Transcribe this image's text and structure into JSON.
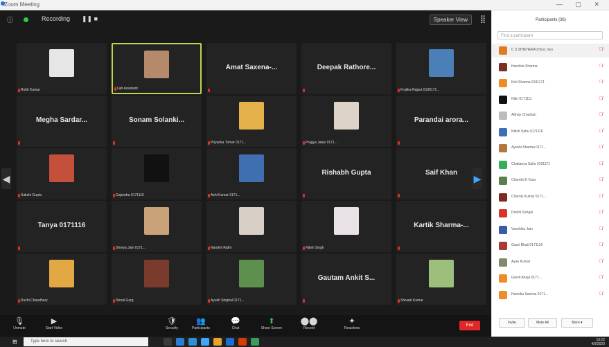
{
  "window": {
    "title": "Zoom Meeting",
    "controls": "— ▢ ✕"
  },
  "topbar": {
    "recording": "Recording",
    "pause_stop": "❚❚ ■",
    "speaker_view": "Speaker View",
    "grid_glyph": "⣿"
  },
  "tiles": [
    {
      "label": "Rohit Kumar",
      "type": "photo",
      "color": "#e6e6e6",
      "active": false
    },
    {
      "label": "Lab Assistant",
      "type": "photo",
      "color": "#b58a6a",
      "active": true
    },
    {
      "label": "",
      "big": "Amat Saxena-...",
      "type": "name",
      "active": false
    },
    {
      "label": "",
      "big": "Deepak Rathore...",
      "type": "name",
      "active": false
    },
    {
      "label": "Krutika Rajput 0190171...",
      "type": "photo",
      "color": "#4a7fb8",
      "active": false
    },
    {
      "label": "",
      "big": "Megha Sardar...",
      "type": "name",
      "active": false
    },
    {
      "label": "",
      "big": "Sonam Solanki...",
      "type": "name",
      "active": false
    },
    {
      "label": "Priyanka Tomar 0171...",
      "type": "photo",
      "color": "#e3b04a",
      "active": false
    },
    {
      "label": "Pragya Jatav 0171...",
      "type": "photo",
      "color": "#ddd3c8",
      "active": false
    },
    {
      "label": "",
      "big": "Parandai arora...",
      "type": "name",
      "active": false
    },
    {
      "label": "Sakshi Gupta",
      "type": "photo",
      "color": "#c4503c",
      "active": false
    },
    {
      "label": "Gajendra 0171116",
      "type": "photo",
      "color": "#111111",
      "active": false
    },
    {
      "label": "Ashi Kumar 0171...",
      "type": "photo",
      "color": "#3f6fb0",
      "active": false
    },
    {
      "label": "",
      "big": "Rishabh Gupta",
      "type": "name",
      "active": false
    },
    {
      "label": "",
      "big": "Saif Khan",
      "type": "name",
      "active": false
    },
    {
      "label": "",
      "big": "Tanya 0171116",
      "type": "name",
      "active": false
    },
    {
      "label": "Shreya Jain 0171...",
      "type": "photo",
      "color": "#c9a27a",
      "active": false
    },
    {
      "label": "Nandini Rathi",
      "type": "photo",
      "color": "#d8d0c6",
      "active": false
    },
    {
      "label": "Nitish Singh",
      "type": "photo",
      "color": "#e9e2e6",
      "active": false
    },
    {
      "label": "",
      "big": "Kartik Sharma-...",
      "type": "name",
      "active": false
    },
    {
      "label": "Ruchi Chaudhary",
      "type": "photo",
      "color": "#e1a844",
      "active": false
    },
    {
      "label": "Shruti Garg",
      "type": "photo",
      "color": "#7a3a2c",
      "active": false
    },
    {
      "label": "Ayush Singhal 0171...",
      "type": "photo",
      "color": "#5d8f4f",
      "active": false
    },
    {
      "label": "",
      "big": "Gautam Ankit S...",
      "type": "name",
      "active": false
    },
    {
      "label": "Shivam Kumar",
      "type": "photo",
      "color": "#9cbf7c",
      "active": false
    }
  ],
  "controls": [
    {
      "icon": "🎙",
      "label": "Unmute"
    },
    {
      "icon": "▶",
      "label": "Start Video"
    },
    {
      "icon": "🛡",
      "label": "Security"
    },
    {
      "icon": "👥",
      "label": "Participants"
    },
    {
      "icon": "💬",
      "label": "Chat"
    },
    {
      "icon": "⬆",
      "label": "Share Screen"
    },
    {
      "icon": "⬤⬤",
      "label": "Record"
    },
    {
      "icon": "✦",
      "label": "Reactions"
    }
  ],
  "end": {
    "label": "End"
  },
  "participants": {
    "title": "Participants (36)",
    "search_placeholder": "Find a participant",
    "items": [
      {
        "name": "C S SHIKHERA (Host, me)",
        "color": "#e07b22"
      },
      {
        "name": "Harshita Sharma",
        "color": "#7a2f22"
      },
      {
        "name": "Kirti Sharma 0191171",
        "color": "#ef8c2a"
      },
      {
        "name": "Nitin 0171111",
        "color": "#111111"
      },
      {
        "name": "Abhay Chauhan",
        "color": "#bcbcbc"
      },
      {
        "name": "Nitish Sahu 0171116",
        "color": "#3e6fb0"
      },
      {
        "name": "Ayushi Sharma 0171...",
        "color": "#b5763b"
      },
      {
        "name": "Chaitanya Sahu 0191171",
        "color": "#35b05a"
      },
      {
        "name": "Chandni K Kaur",
        "color": "#5b7f4c"
      },
      {
        "name": "Charoly Kumar 0171...",
        "color": "#7a2b22"
      },
      {
        "name": "Drishti Sehgal",
        "color": "#d9332c"
      },
      {
        "name": "Vanshika Jain",
        "color": "#3a5ba8"
      },
      {
        "name": "Gauri Bhati 0171116",
        "color": "#a53c35"
      },
      {
        "name": "Ayan Kumar",
        "color": "#808b6d"
      },
      {
        "name": "Garvit Ahuja 0171...",
        "color": "#ef8c2a"
      },
      {
        "name": "Hansika Saxena 0171...",
        "color": "#ef8c2a"
      }
    ],
    "buttons": [
      "Invite",
      "Mute All",
      "More ▾"
    ]
  },
  "taskbar": {
    "search": "Type here to search",
    "time": "10:22",
    "date": "4/9/2020"
  }
}
